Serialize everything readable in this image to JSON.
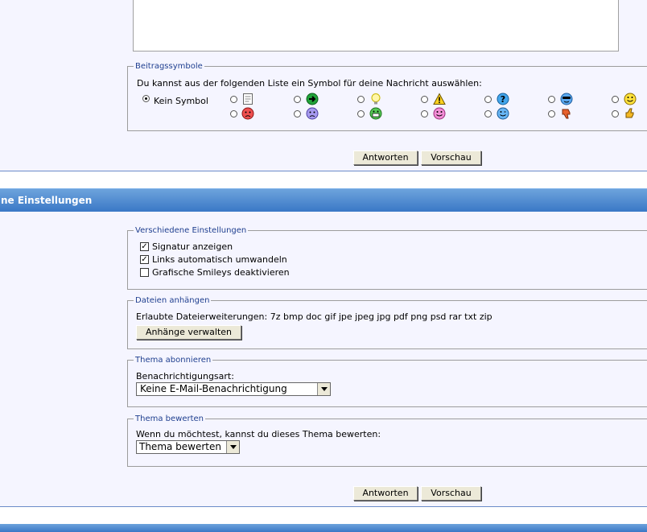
{
  "symbols": {
    "legend": "Beitragssymbole",
    "instruction": "Du kannst aus der folgenden Liste ein Symbol für deine Nachricht auswählen:",
    "none_label": "Kein Symbol",
    "row1": [
      "note-icon",
      "arrow-right-icon",
      "lightbulb-icon",
      "warning-icon",
      "question-icon",
      "cool-smiley-icon",
      "smiley-icon"
    ],
    "row2": [
      "angry-icon",
      "sad-icon",
      "grin-icon",
      "tongue-icon",
      "wink-icon",
      "thumbs-down-icon",
      "thumbs-up-icon"
    ]
  },
  "buttons": {
    "reply": "Antworten",
    "preview": "Vorschau"
  },
  "settings_header": "ne Einstellungen",
  "misc": {
    "legend": "Verschiedene Einstellungen",
    "options": [
      {
        "label": "Signatur anzeigen",
        "checked": true
      },
      {
        "label": "Links automatisch umwandeln",
        "checked": true
      },
      {
        "label": "Grafische Smileys deaktivieren",
        "checked": false
      }
    ]
  },
  "attachments": {
    "legend": "Dateien anhängen",
    "allowed": "Erlaubte Dateierweiterungen: 7z bmp doc gif jpe jpeg jpg pdf png psd rar txt zip",
    "manage_button": "Anhänge verwalten"
  },
  "subscribe": {
    "legend": "Thema abonnieren",
    "label": "Benachrichtigungsart:",
    "selected": "Keine E-Mail-Benachrichtigung"
  },
  "rate": {
    "legend": "Thema bewerten",
    "label": "Wenn du möchtest, kannst du dieses Thema bewerten:",
    "selected": "Thema bewerten"
  }
}
